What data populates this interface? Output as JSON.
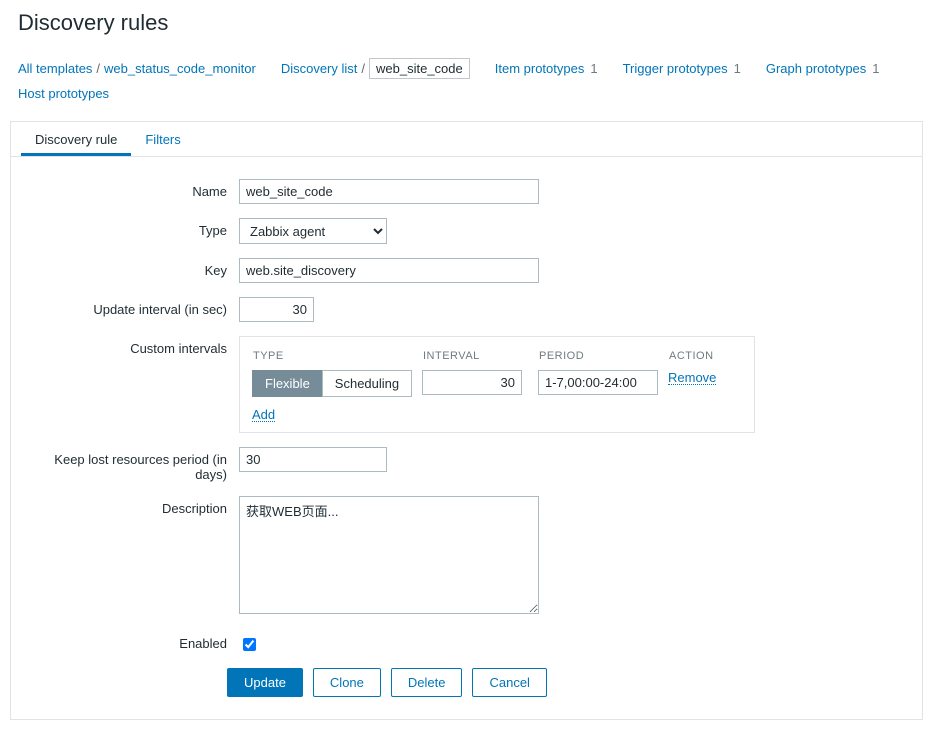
{
  "page_title": "Discovery rules",
  "breadcrumbs": {
    "all_templates": "All templates",
    "template": "web_status_code_monitor",
    "discovery_list": "Discovery list",
    "current": "web_site_code",
    "item_proto": {
      "label": "Item prototypes",
      "count": "1"
    },
    "trigger_proto": {
      "label": "Trigger prototypes",
      "count": "1"
    },
    "graph_proto": {
      "label": "Graph prototypes",
      "count": "1"
    },
    "host_proto": {
      "label": "Host prototypes"
    }
  },
  "tabs": {
    "discovery_rule": "Discovery rule",
    "filters": "Filters"
  },
  "form": {
    "name": {
      "label": "Name",
      "value": "web_site_code"
    },
    "type": {
      "label": "Type",
      "value": "Zabbix agent"
    },
    "key": {
      "label": "Key",
      "value": "web.site_discovery"
    },
    "update_interval": {
      "label": "Update interval (in sec)",
      "value": "30"
    },
    "custom_intervals": {
      "label": "Custom intervals",
      "headers": {
        "type": "TYPE",
        "interval": "INTERVAL",
        "period": "PERIOD",
        "action": "ACTION"
      },
      "seg": {
        "flexible": "Flexible",
        "scheduling": "Scheduling"
      },
      "row": {
        "interval": "30",
        "period": "1-7,00:00-24:00"
      },
      "remove": "Remove",
      "add": "Add"
    },
    "keep_lost": {
      "label": "Keep lost resources period (in days)",
      "value": "30"
    },
    "description": {
      "label": "Description",
      "value": "获取WEB页面..."
    },
    "enabled": {
      "label": "Enabled"
    }
  },
  "buttons": {
    "update": "Update",
    "clone": "Clone",
    "delete": "Delete",
    "cancel": "Cancel"
  }
}
